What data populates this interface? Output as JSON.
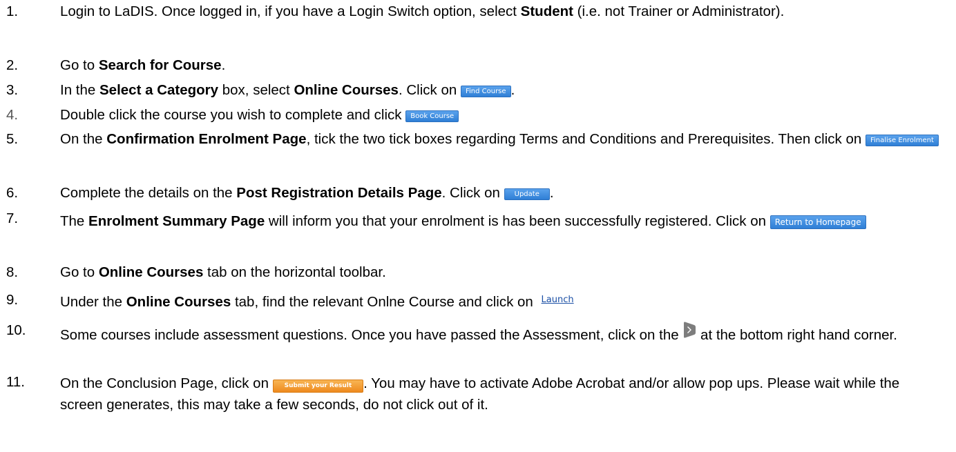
{
  "steps": [
    {
      "num": "1.",
      "a": "Login to LaDIS. Once logged in, if you have a Login Switch option, select ",
      "b": "Student",
      "c": " (i.e. not Trainer or Administrator)."
    },
    {
      "num": "2.",
      "a": "Go to ",
      "b": "Search for Course",
      "c": "."
    },
    {
      "num": "3.",
      "a": "In the ",
      "b": "Select a Category",
      "c": " box, select ",
      "d": "Online Courses",
      "e": ". Click on ",
      "btn": "Find Course",
      "f": "."
    },
    {
      "num": "4.",
      "a": "Double click the course you wish to complete and click ",
      "btn": "Book Course"
    },
    {
      "num": "5.",
      "a": "On the ",
      "b": "Confirmation Enrolment Page",
      "c": ", tick the two tick boxes regarding Terms and Conditions and Prerequisites. Then click on ",
      "btn": "Finalise Enrolment"
    },
    {
      "num": "6.",
      "a": "Complete the details on the ",
      "b": "Post Registration Details Page",
      "c": ". Click on ",
      "btn": "Update",
      "d": "."
    },
    {
      "num": "7.",
      "a": "The ",
      "b": "Enrolment Summary Page",
      "c": " will inform you that your enrolment is has been successfully registered. Click on ",
      "btn": "Return to Homepage"
    },
    {
      "num": "8.",
      "a": "Go to ",
      "b": "Online Courses",
      "c": " tab on the horizontal toolbar."
    },
    {
      "num": "9.",
      "a": "Under the ",
      "b": "Online Courses",
      "c": " tab, find the relevant Onlne Course and click on ",
      "link": "Launch"
    },
    {
      "num": "10.",
      "a": "Some courses include assessment questions.  Once you have passed the Assessment, click on the ",
      "icon": "next-arrow-icon",
      "c": " at the bottom right hand corner."
    },
    {
      "num": "11.",
      "a": "On the Conclusion Page, click on ",
      "btn": "Submit your Result",
      "c": ". You may have to activate Adobe Acrobat and/or allow pop ups. Please wait while the screen generates, this may take a few seconds, do not click out of it."
    }
  ],
  "colors": {
    "blue_button": "#2f7fd6",
    "orange_button": "#ee8a1e",
    "link": "#1a4fa5",
    "icon_grey": "#7d7d7d"
  }
}
